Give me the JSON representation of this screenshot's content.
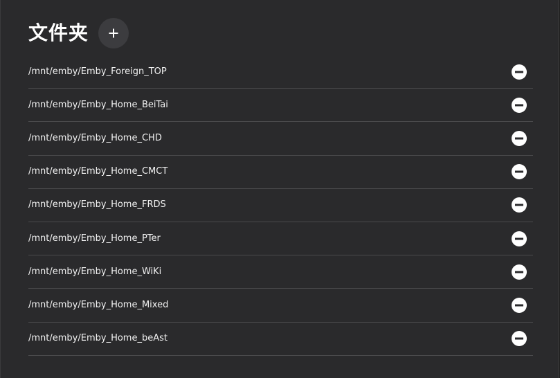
{
  "header": {
    "title": "文件夹",
    "add_icon": "plus-icon"
  },
  "folders": [
    {
      "path": "/mnt/emby/Emby_Foreign_TOP",
      "remove_icon": "minus-circle-icon"
    },
    {
      "path": "/mnt/emby/Emby_Home_BeiTai",
      "remove_icon": "minus-circle-icon"
    },
    {
      "path": "/mnt/emby/Emby_Home_CHD",
      "remove_icon": "minus-circle-icon"
    },
    {
      "path": "/mnt/emby/Emby_Home_CMCT",
      "remove_icon": "minus-circle-icon"
    },
    {
      "path": "/mnt/emby/Emby_Home_FRDS",
      "remove_icon": "minus-circle-icon"
    },
    {
      "path": "/mnt/emby/Emby_Home_PTer",
      "remove_icon": "minus-circle-icon"
    },
    {
      "path": "/mnt/emby/Emby_Home_WiKi",
      "remove_icon": "minus-circle-icon"
    },
    {
      "path": "/mnt/emby/Emby_Home_Mixed",
      "remove_icon": "minus-circle-icon"
    },
    {
      "path": "/mnt/emby/Emby_Home_beAst",
      "remove_icon": "minus-circle-icon"
    }
  ],
  "colors": {
    "background": "#2a2a2c",
    "add_button_bg": "#3c3c3f",
    "divider": "#4a4a4c",
    "text": "#ffffff"
  }
}
